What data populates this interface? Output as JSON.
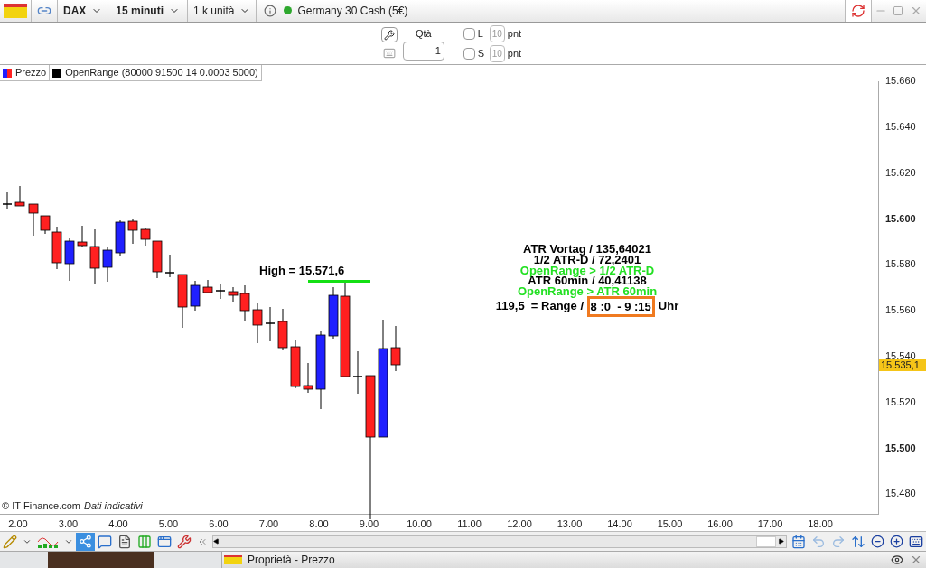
{
  "toolbar": {
    "instrument": "DAX",
    "timeframe": "15 minuti",
    "units": "1 k unità",
    "connected": true,
    "market": "Germany 30 Cash (5€)"
  },
  "order_panel": {
    "qty_label": "Qtà",
    "qty": "1",
    "sides": [
      {
        "label": "L",
        "checked": false,
        "placeholder": "10",
        "unit": "pnt"
      },
      {
        "label": "S",
        "checked": false,
        "placeholder": "10",
        "unit": "pnt"
      }
    ]
  },
  "legend": [
    {
      "kind": "price",
      "label": "Prezzo"
    },
    {
      "kind": "indicator",
      "label": "OpenRange (80000 91500 14 0.0003 5000)"
    }
  ],
  "chart": {
    "high_label": "High = 15.571,6",
    "annotations": [
      {
        "kind": "info",
        "text": "ATR Vortag / 135,64021"
      },
      {
        "kind": "info",
        "text": "1/2 ATR-D / 72,2401"
      },
      {
        "kind": "signal",
        "text": "OpenRange > 1/2 ATR-D"
      },
      {
        "kind": "info",
        "text": "ATR 60min / 40,41138"
      },
      {
        "kind": "signal",
        "text": "OpenRange > ATR 60min"
      }
    ],
    "range": {
      "value": "119,5  = Range / ",
      "time": "8 :0  - 9 :15",
      "unit": "Uhr"
    },
    "price_ticks": [
      {
        "label": "15.660",
        "major": false
      },
      {
        "label": "15.640",
        "major": false
      },
      {
        "label": "15.620",
        "major": false
      },
      {
        "label": "15.600",
        "major": true
      },
      {
        "label": "15.580",
        "major": false
      },
      {
        "label": "15.560",
        "major": false
      },
      {
        "label": "15.540",
        "major": false
      },
      {
        "label": "15.520",
        "major": false
      },
      {
        "label": "15.500",
        "major": true
      },
      {
        "label": "15.480",
        "major": false
      }
    ],
    "current_price": "15.535,1",
    "time_ticks": [
      "2.00",
      "3.00",
      "4.00",
      "5.00",
      "6.00",
      "7.00",
      "8.00",
      "9.00",
      "10.00",
      "11.00",
      "12.00",
      "13.00",
      "14.00",
      "15.00",
      "16.00",
      "17.00",
      "18.00"
    ],
    "credit": "© IT-Finance.com",
    "notice": "Dati indicativi"
  },
  "properties_panel": {
    "title": "Proprietà - Prezzo"
  }
}
